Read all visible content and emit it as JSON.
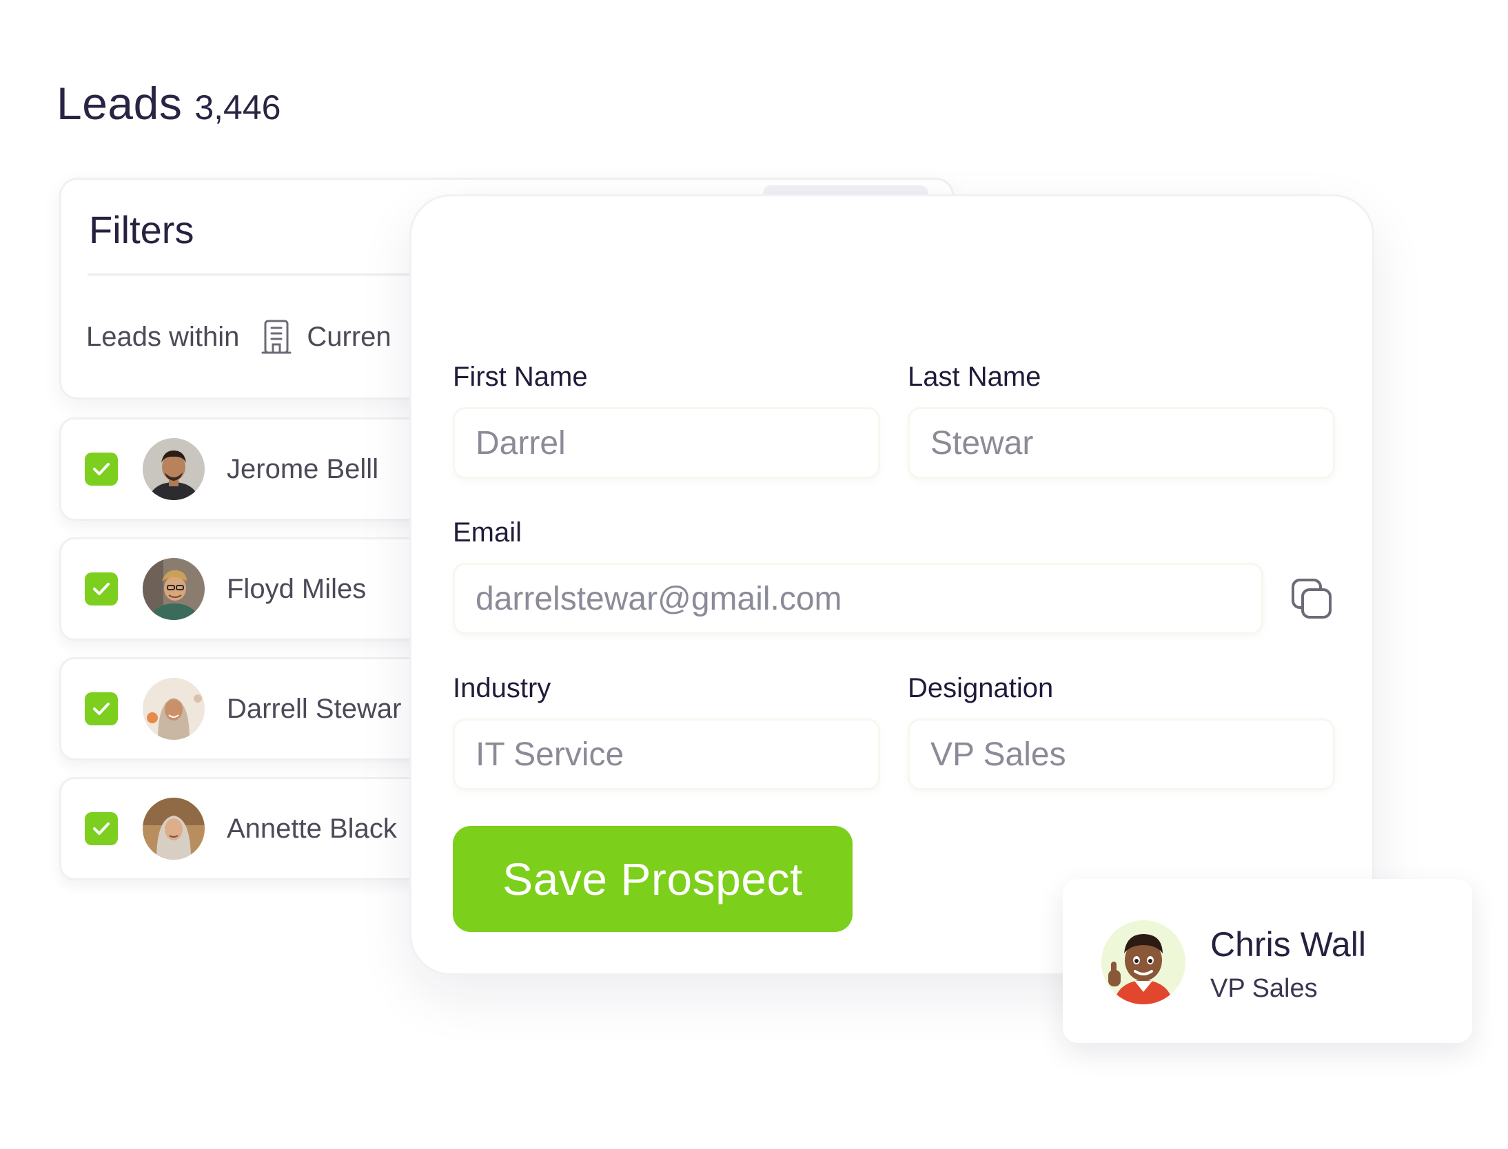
{
  "header": {
    "title": "Leads",
    "count": "3,446"
  },
  "filters": {
    "title": "Filters",
    "leads_within_label": "Leads within",
    "scope_value": "Curren"
  },
  "leads": [
    {
      "name": "Jerome Belll",
      "checked": true
    },
    {
      "name": "Floyd Miles",
      "checked": true
    },
    {
      "name": "Darrell Stewar",
      "checked": true
    },
    {
      "name": "Annette Black",
      "checked": true
    }
  ],
  "form": {
    "first_name_label": "First Name",
    "first_name_value": "Darrel",
    "last_name_label": "Last Name",
    "last_name_value": "Stewar",
    "email_label": "Email",
    "email_value": "darrelstewar@gmail.com",
    "industry_label": "Industry",
    "industry_value": "IT Service",
    "designation_label": "Designation",
    "designation_value": "VP Sales",
    "save_label": "Save Prospect"
  },
  "contact": {
    "name": "Chris Wall",
    "role": "VP Sales"
  },
  "colors": {
    "accent": "#7ccf1a",
    "title_text": "#27213f",
    "muted_text": "#8b8b98"
  }
}
